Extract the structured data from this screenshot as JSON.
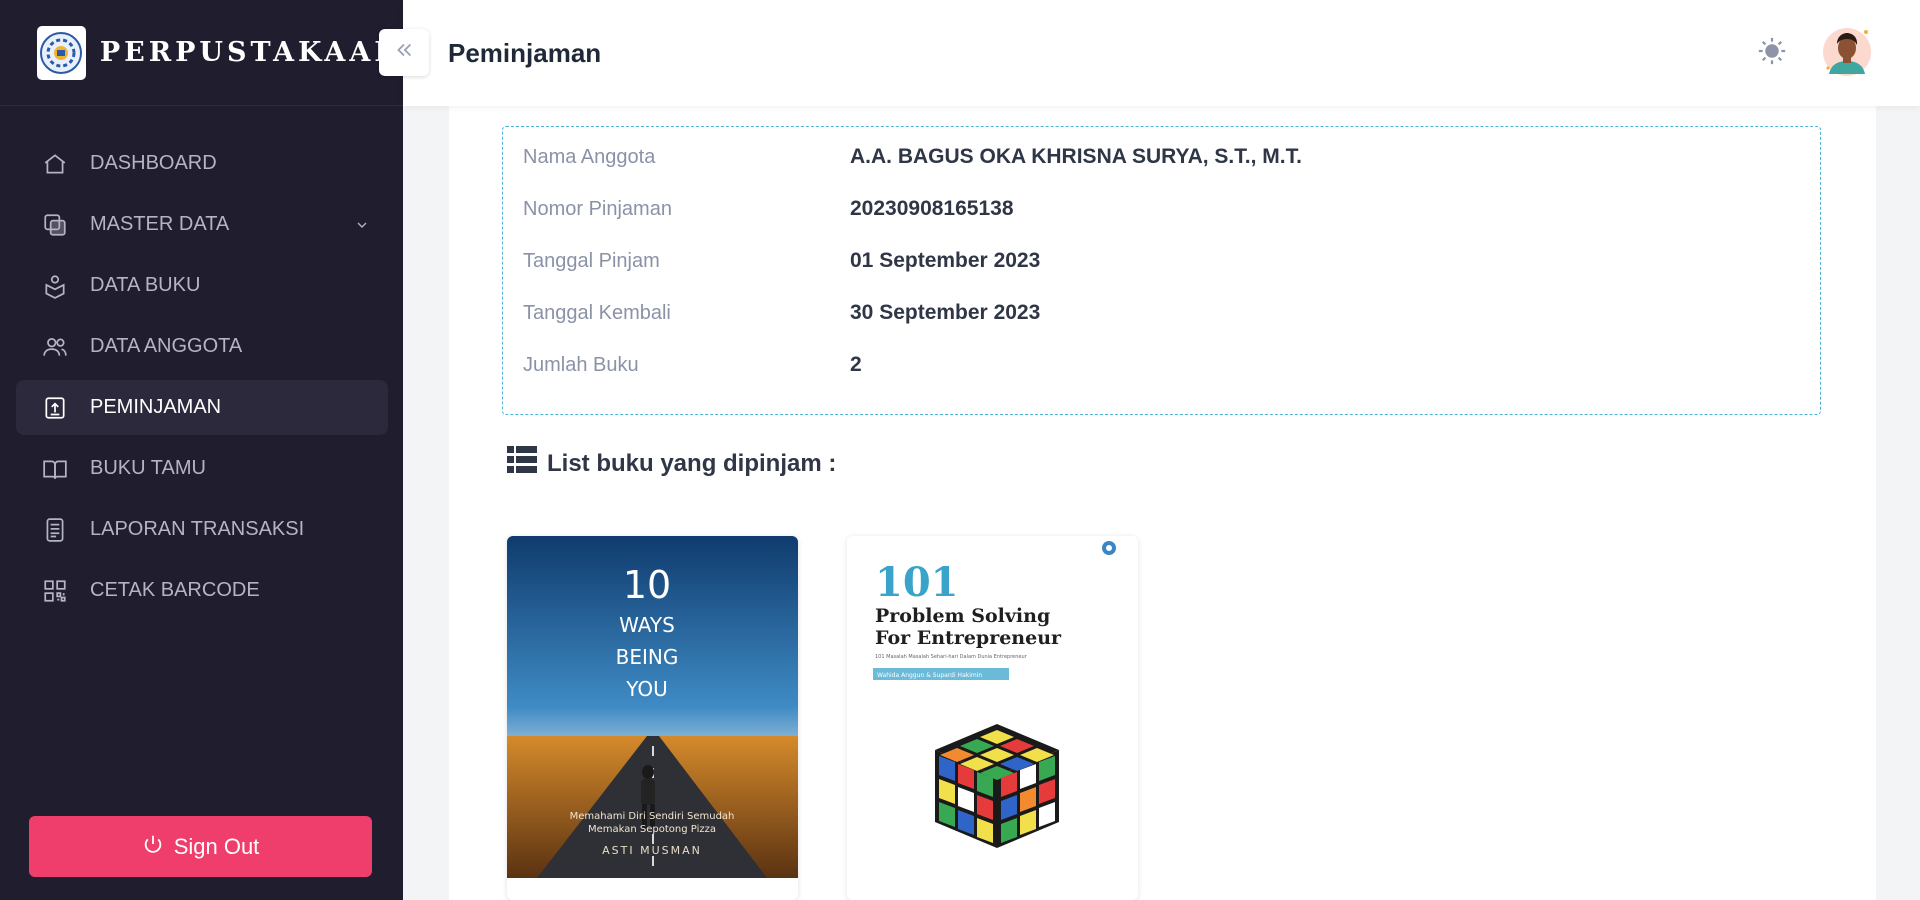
{
  "brand": {
    "name": "PERPUSTAKAAN"
  },
  "header": {
    "title": "Peminjaman"
  },
  "sidebar": {
    "items": [
      {
        "label": "DASHBOARD",
        "icon": "home-icon"
      },
      {
        "label": "MASTER DATA",
        "icon": "layers-icon"
      },
      {
        "label": "DATA BUKU",
        "icon": "book-reader-icon"
      },
      {
        "label": "DATA ANGGOTA",
        "icon": "users-icon"
      },
      {
        "label": "PEMINJAMAN",
        "icon": "loan-icon"
      },
      {
        "label": "BUKU TAMU",
        "icon": "open-book-icon"
      },
      {
        "label": "LAPORAN TRANSAKSI",
        "icon": "report-icon"
      },
      {
        "label": "CETAK BARCODE",
        "icon": "qr-code-icon"
      }
    ],
    "signout_label": "Sign Out"
  },
  "info": {
    "rows": [
      {
        "label": "Nama Anggota",
        "value": "A.A. BAGUS OKA KHRISNA SURYA, S.T., M.T."
      },
      {
        "label": "Nomor Pinjaman",
        "value": "20230908165138"
      },
      {
        "label": "Tanggal Pinjam",
        "value": "01 September 2023"
      },
      {
        "label": "Tanggal Kembali",
        "value": "30 September 2023"
      },
      {
        "label": "Jumlah Buku",
        "value": "2"
      }
    ]
  },
  "books_section": {
    "title": "List buku yang dipinjam :",
    "books": [
      {
        "cover_num": "10",
        "cover_line1": "WAYS",
        "cover_line2": "BEING",
        "cover_line3": "YOU",
        "subtitle1": "Memahami Diri Sendiri Semudah",
        "subtitle2": "Memakan Sepotong Pizza",
        "author": "ASTI MUSMAN"
      },
      {
        "cover_num": "101",
        "cover_line1": "Problem Solving",
        "cover_line2": "For Entrepreneur",
        "subtitle1": "101 Masalah Masalah Sehari-hari Dalam Dunia Entrepreneur",
        "author": "Wahida Anggun & Supardi Hakimin"
      }
    ]
  },
  "colors": {
    "sidebar_bg": "#1f1d2e",
    "accent": "#ef3e6c",
    "info_border": "#4fb3d9"
  }
}
